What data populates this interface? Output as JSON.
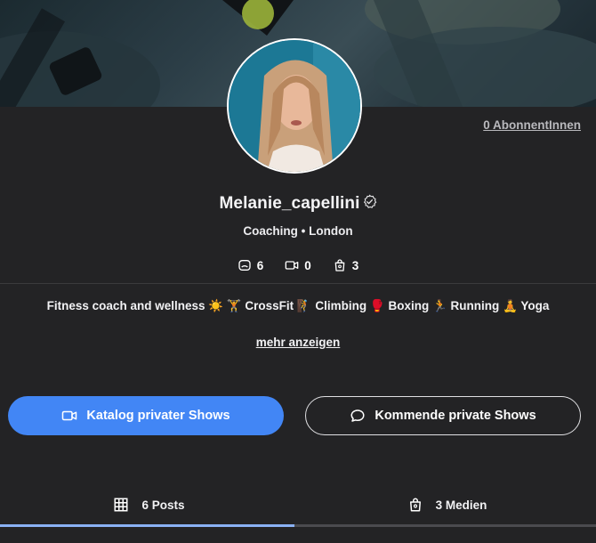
{
  "profile": {
    "username": "Melanie_capellini",
    "meta": "Coaching • London",
    "subscribers_link": "0 AbonnentInnen"
  },
  "stats": [
    {
      "icon": "post-icon",
      "value": "6"
    },
    {
      "icon": "video-icon",
      "value": "0"
    },
    {
      "icon": "bag-icon",
      "value": "3"
    }
  ],
  "bio": {
    "text": "Fitness coach and wellness ☀️ 🏋 CrossFit 🧗 Climbing 🥊 Boxing 🏃 Running 🧘 Yoga",
    "more_link": "mehr anzeigen"
  },
  "actions": {
    "primary_label": "Katalog privater Shows",
    "secondary_label": "Kommende private Shows"
  },
  "tabs": [
    {
      "icon": "grid-icon",
      "label": "6 Posts",
      "active": true
    },
    {
      "icon": "bag-icon",
      "label": "3 Medien",
      "active": false
    }
  ],
  "colors": {
    "background": "#232325",
    "primary_button": "#4286f5",
    "active_tab_indicator": "#8ab1f4"
  }
}
